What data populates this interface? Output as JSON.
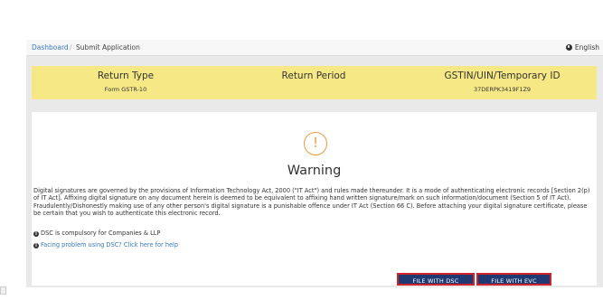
{
  "breadcrumb": {
    "dashboard": "Dashboard",
    "separator": "/",
    "current": "Submit Application"
  },
  "language": {
    "icon": "globe-icon",
    "label": "English"
  },
  "summary": {
    "return_type": {
      "header": "Return Type",
      "value": "Form GSTR-10"
    },
    "return_period": {
      "header": "Return Period",
      "value": ""
    },
    "gstin": {
      "header": "GSTIN/UIN/Temporary ID",
      "value": "37DERPK3419F1Z9"
    }
  },
  "warning": {
    "icon": "exclamation-circle-icon",
    "symbol": "!",
    "title": "Warning",
    "body": "Digital signatures are governed by the provisions of Information Technology Act, 2000 (\"IT Act\") and rules made thereunder. It is a mode of authenticating electronic records [Section 2(p) of IT Act]. Affixing digital signature on any document herein is deemed to be equivalent to affixing hand written signature/mark on such information/document (Section 5 of IT Act). Fraudulently/Dishonestly making use of any other person's digital signature is a punishable offence under IT Act (Section 66 C). Before attaching your digital signature certificate, please be certain that you wish to authenticate this electronic record.",
    "dsc_note": "DSC is compulsory for Companies & LLP",
    "help_link": "Facing problem using DSC? Click here for help"
  },
  "buttons": {
    "file_dsc": "FILE WITH DSC",
    "file_evc": "FILE WITH EVC"
  },
  "colors": {
    "accent": "#1f3a73",
    "highlight": "#f6e884",
    "warning": "#ef9a3c",
    "button_border": "#d0232a"
  }
}
